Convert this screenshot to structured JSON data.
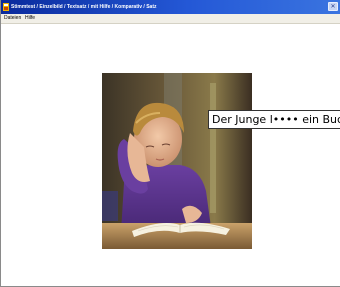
{
  "window": {
    "title": "Stimmtest / Einzelbild / Textsatz / mit Hilfe / Komparativ / Satz",
    "close_glyph": "✕"
  },
  "menu": {
    "items": [
      {
        "label": "Dateien"
      },
      {
        "label": "Hilfe"
      }
    ]
  },
  "content": {
    "image_icon": "boy-reading-book-photo",
    "caption": "Der Junge l•••• ein Buch."
  }
}
